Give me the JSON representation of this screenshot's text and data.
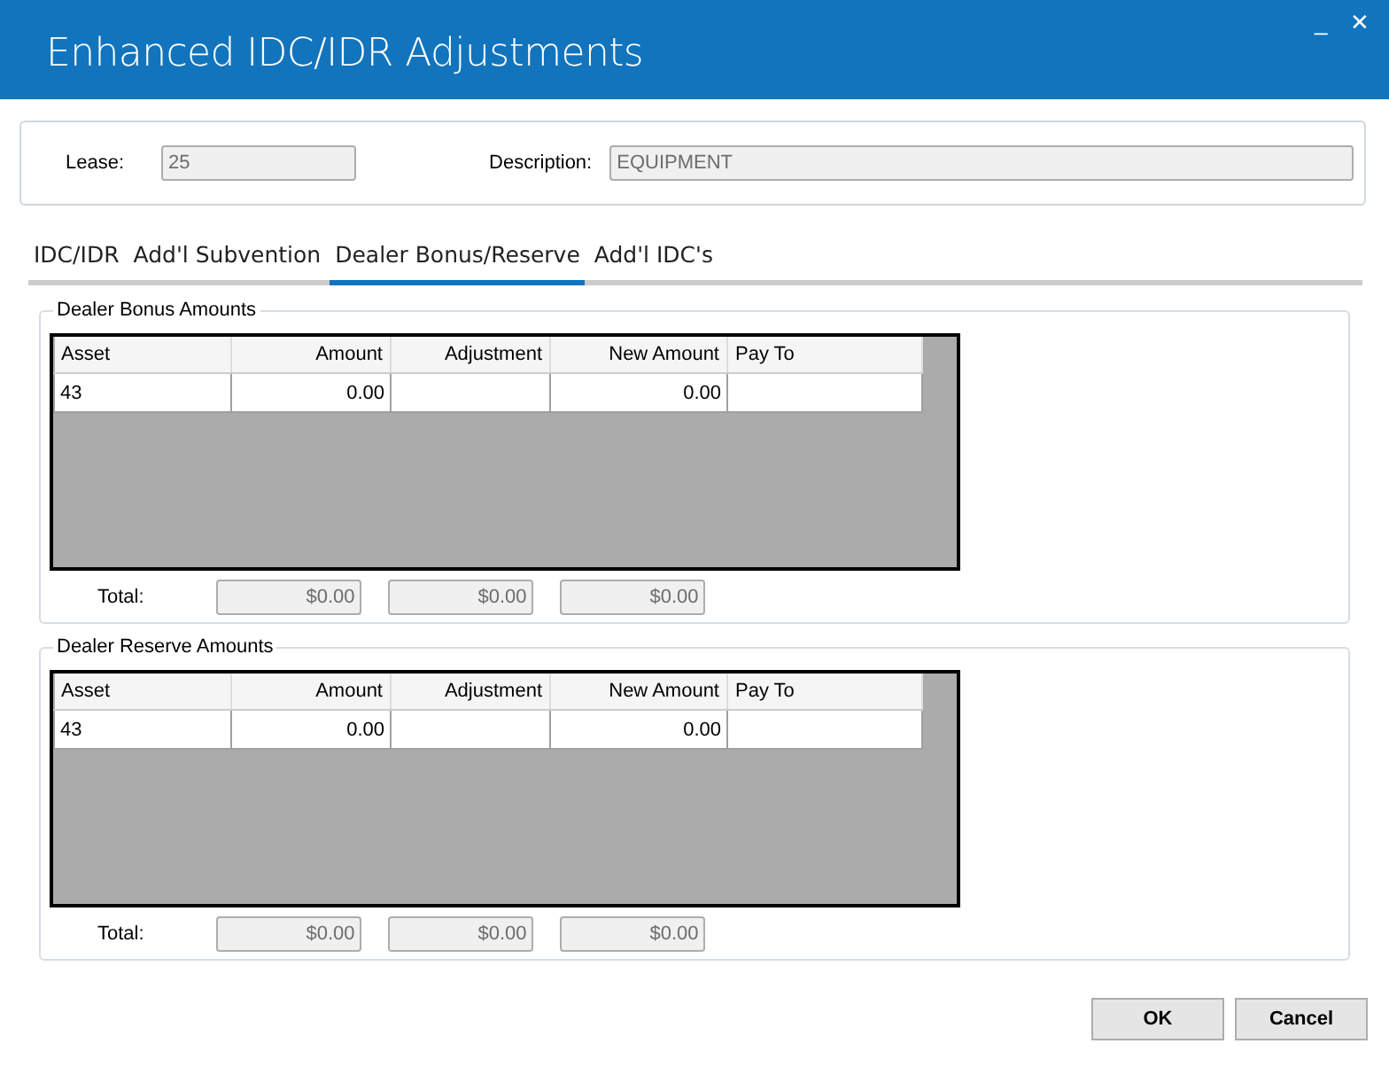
{
  "window": {
    "title": "Enhanced IDC/IDR Adjustments",
    "controls": [
      "_",
      "✕"
    ]
  },
  "header": {
    "lease_label": "Lease:",
    "lease_value": "25",
    "description_label": "Description:",
    "description_value": "EQUIPMENT"
  },
  "tabs": [
    {
      "label": "IDC/IDR",
      "selected": false
    },
    {
      "label": "Add'l Subvention",
      "selected": false
    },
    {
      "label": "Dealer Bonus/Reserve",
      "selected": true
    },
    {
      "label": "Add'l IDC's",
      "selected": false
    }
  ],
  "groups": [
    {
      "title": "Dealer Bonus Amounts",
      "columns": [
        {
          "label": "Asset",
          "kind": "text"
        },
        {
          "label": "Amount",
          "kind": "number"
        },
        {
          "label": "Adjustment",
          "kind": "number"
        },
        {
          "label": "New Amount",
          "kind": "number"
        },
        {
          "label": "Pay To",
          "kind": "text"
        }
      ],
      "rows": [
        [
          "43",
          "0.00",
          "",
          "0.00",
          ""
        ]
      ],
      "total_label": "Total:",
      "totals": [
        "$0.00",
        "$0.00",
        "$0.00"
      ]
    },
    {
      "title": "Dealer Reserve Amounts",
      "columns": [
        {
          "label": "Asset",
          "kind": "text"
        },
        {
          "label": "Amount",
          "kind": "number"
        },
        {
          "label": "Adjustment",
          "kind": "number"
        },
        {
          "label": "New Amount",
          "kind": "number"
        },
        {
          "label": "Pay To",
          "kind": "text"
        }
      ],
      "rows": [
        [
          "43",
          "0.00",
          "",
          "0.00",
          ""
        ]
      ],
      "total_label": "Total:",
      "totals": [
        "$0.00",
        "$0.00",
        "$0.00"
      ]
    }
  ],
  "buttons": [
    "OK",
    "Cancel"
  ]
}
